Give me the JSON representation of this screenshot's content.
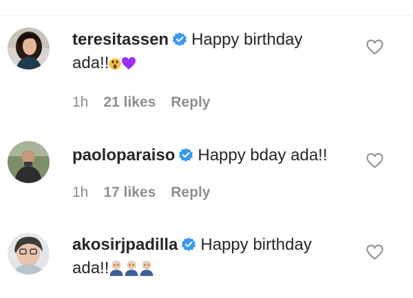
{
  "comments": [
    {
      "username": "teresitassen",
      "text_line1": "Happy birthday",
      "text_line2": "ada!!",
      "emoji": [
        "astonished-face",
        "purple-heart"
      ],
      "time": "1h",
      "likes": "21 likes",
      "reply": "Reply"
    },
    {
      "username": "paoloparaiso",
      "text_line1": "Happy bday ada!!",
      "time": "1h",
      "likes": "17 likes",
      "reply": "Reply"
    },
    {
      "username": "akosirjpadilla",
      "text_line1": "Happy birthday",
      "text_line2": "ada!!",
      "emoji": [
        "older-person",
        "older-person",
        "older-person"
      ]
    }
  ],
  "icons": {
    "verified_badge": "verified-badge-icon",
    "like": "heart-outline-icon"
  },
  "colors": {
    "verified_blue": "#3897f0",
    "meta_gray": "#8e8e8e",
    "text": "#262626",
    "heart_stroke": "#8e8e8e",
    "purple_heart": "#9b30ff"
  }
}
